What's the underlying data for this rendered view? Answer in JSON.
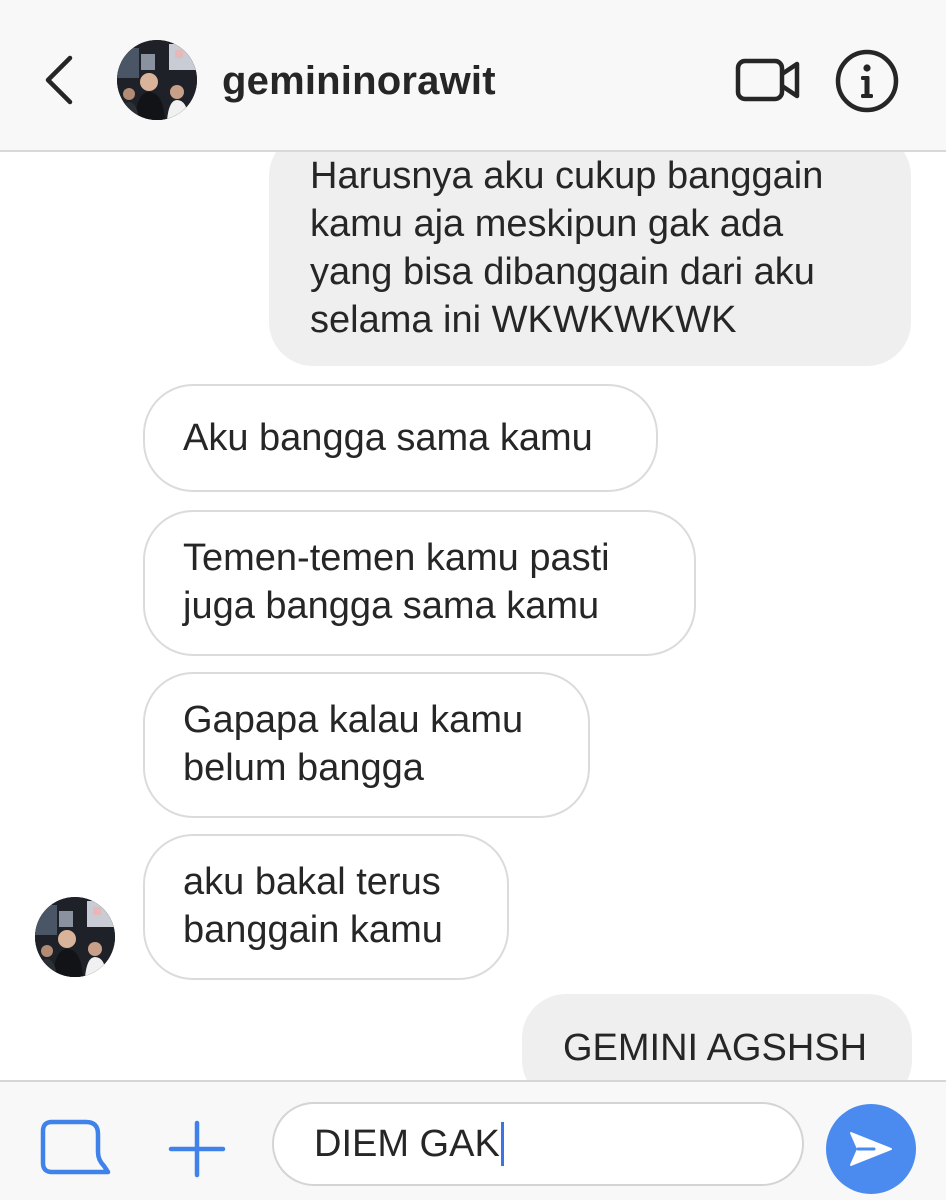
{
  "header": {
    "username": "gemininorawit",
    "back_icon": "chevron-left-icon",
    "video_icon": "video-camera-icon",
    "info_icon": "info-icon"
  },
  "messages": [
    {
      "direction": "sent",
      "text": "Harusnya aku cukup banggain\nkamu aja meskipun gak ada\nyang bisa dibanggain dari aku\nselama ini WKWKWKWK"
    },
    {
      "direction": "received",
      "text": "Aku bangga sama kamu"
    },
    {
      "direction": "received",
      "text": "Temen-temen kamu pasti\njuga bangga sama kamu"
    },
    {
      "direction": "received",
      "text": "Gapapa kalau kamu\nbelum bangga"
    },
    {
      "direction": "received",
      "text": "aku bakal terus\nbanggain kamu"
    },
    {
      "direction": "sent",
      "text": "GEMINI AGSHSH"
    }
  ],
  "composer": {
    "input_value": "DIEM GAK",
    "gallery_icon": "gallery-icon",
    "plus_icon": "plus-icon",
    "send_icon": "send-icon"
  },
  "colors": {
    "sent_bubble": "#efefef",
    "received_border": "#dbdbdb",
    "send_button": "#4b8bf0",
    "accent_icon": "#3f82ea"
  }
}
